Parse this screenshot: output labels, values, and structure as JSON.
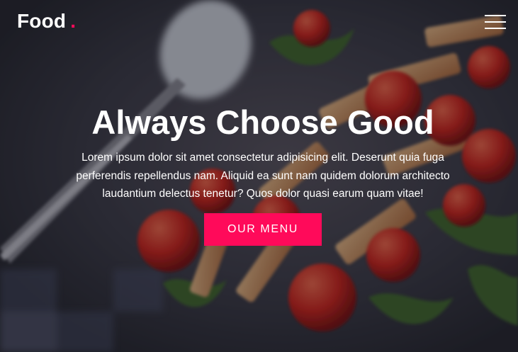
{
  "navbar": {
    "brand": "Food",
    "brand_dot": ".",
    "menu_icon": "hamburger-menu-icon"
  },
  "hero": {
    "title": "Always Choose Good",
    "description": "Lorem ipsum dolor sit amet consectetur adipisicing elit. Deserunt quia fuga perferendis repellendus nam. Aliquid ea sunt nam quidem dolorum architecto laudantium delectus tenetur? Quos dolor quasi earum quam vitae!",
    "cta_label": "OUR MENU",
    "background": "food-pasta-tomatoes-photo"
  },
  "colors": {
    "accent": "#ff0a5a",
    "text": "#ffffff"
  }
}
